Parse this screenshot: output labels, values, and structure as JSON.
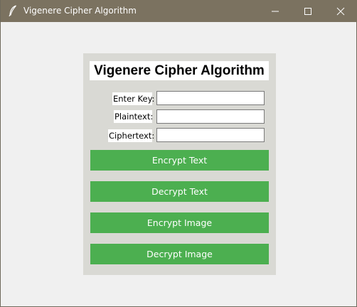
{
  "window": {
    "title": "Vigenere Cipher Algorithm",
    "icon": "feather-icon",
    "controls": [
      "minimize-icon",
      "maximize-icon",
      "close-icon"
    ]
  },
  "app": {
    "heading": "Vigenere Cipher Algorithm",
    "fields": [
      {
        "label": "Enter Key:",
        "value": "",
        "placeholder": ""
      },
      {
        "label": "Plaintext:",
        "value": "",
        "placeholder": ""
      },
      {
        "label": "Ciphertext:",
        "value": "",
        "placeholder": ""
      }
    ],
    "buttons": [
      {
        "label": "Encrypt Text"
      },
      {
        "label": "Decrypt Text"
      },
      {
        "label": "Encrypt Image"
      },
      {
        "label": "Decrypt Image"
      }
    ]
  },
  "colors": {
    "titlebar": "#7b7260",
    "window_bg": "#f0f0f0",
    "panel_bg": "#d9d9d4",
    "button_bg": "#4caf50",
    "button_text": "#ffffff"
  }
}
